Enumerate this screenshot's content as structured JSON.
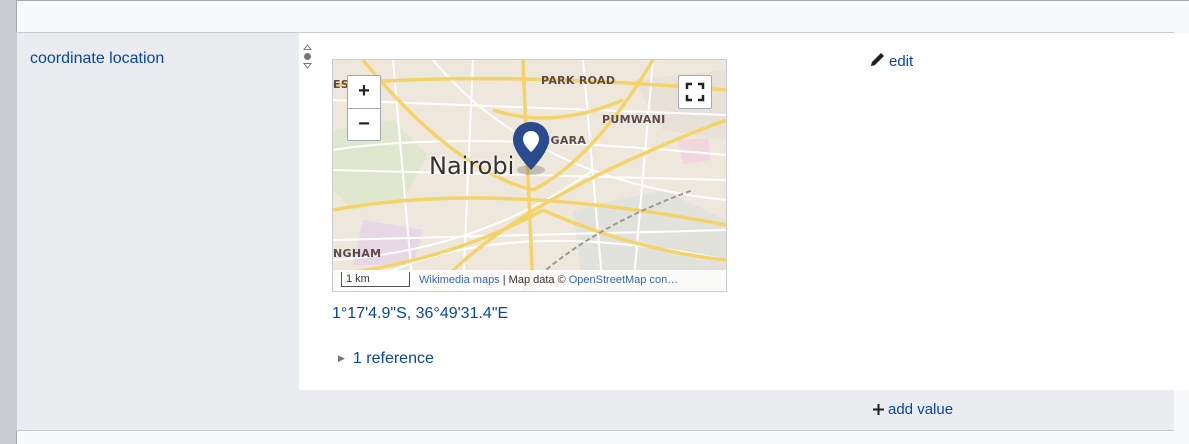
{
  "property": {
    "label": "coordinate location"
  },
  "map": {
    "places": [
      "PARK ROAD",
      "NGARA",
      "PUMWANI",
      "NGHAM",
      "ES"
    ],
    "city": "Nairobi",
    "zoom_in": "+",
    "zoom_out": "−",
    "scale": "1 km",
    "attribution": {
      "wikimedia": "Wikimedia maps",
      "mapdata": " | Map data © ",
      "osm": "OpenStreetMap con…"
    }
  },
  "coordinates": "1°17'4.9\"S, 36°49'31.4\"E",
  "references": {
    "label": "1 reference"
  },
  "edit_label": "edit",
  "add_value_label": "add value",
  "colors": {
    "link": "#0645ad",
    "pin": "#2a4b8d",
    "background": "#eaecf0"
  },
  "icons": [
    "rank-normal-icon",
    "pencil-icon",
    "plus-icon",
    "map-pin-icon",
    "fullscreen-icon",
    "expand-triangle-icon"
  ]
}
